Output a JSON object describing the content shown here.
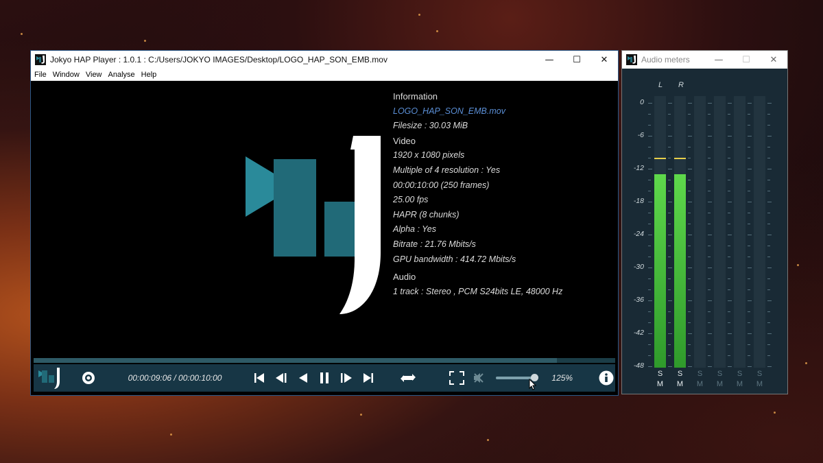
{
  "player": {
    "title": "Jokyo HAP Player : 1.0.1 : C:/Users/JOKYO IMAGES/Desktop/LOGO_HAP_SON_EMB.mov",
    "menu": [
      "File",
      "Window",
      "View",
      "Analyse",
      "Help"
    ],
    "window_buttons": {
      "minimize": "—",
      "maximize": "☐",
      "close": "✕"
    },
    "info": {
      "heading": "Information",
      "filename": "LOGO_HAP_SON_EMB.mov",
      "filesize": "Filesize : 30.03 MiB",
      "video_heading": "Video",
      "resolution": "1920 x 1080 pixels",
      "multiple4": "Multiple of 4 resolution : Yes",
      "duration": "00:00:10:00 (250 frames)",
      "fps": "25.00 fps",
      "codec": "HAPR (8 chunks)",
      "alpha": "Alpha : Yes",
      "bitrate": "Bitrate : 21.76 Mbits/s",
      "gpu_bandwidth": "GPU bandwidth : 414.72 Mbits/s",
      "audio_heading": "Audio",
      "audio_track": "1 track : Stereo , PCM S24bits LE, 48000 Hz"
    },
    "controls": {
      "time": "00:00:09:06  /  00:00:10:00",
      "zoom": "125%",
      "progress": 0.9,
      "volume": 0.95
    },
    "colors": {
      "accent": "#2a8a9a",
      "logo_teal": "#216a78",
      "bar": "#173645"
    }
  },
  "meters": {
    "title": "Audio meters",
    "window_buttons": {
      "minimize": "—",
      "maximize": "☐",
      "close": "✕"
    },
    "channels": [
      "L",
      "R"
    ],
    "scale": [
      "0",
      "-6",
      "-12",
      "-18",
      "-24",
      "-30",
      "-36",
      "-42",
      "-48"
    ],
    "levels_db": [
      -13,
      -13
    ],
    "peaks_db": [
      -10,
      -10
    ],
    "solo_label": "S",
    "mute_label": "M"
  }
}
